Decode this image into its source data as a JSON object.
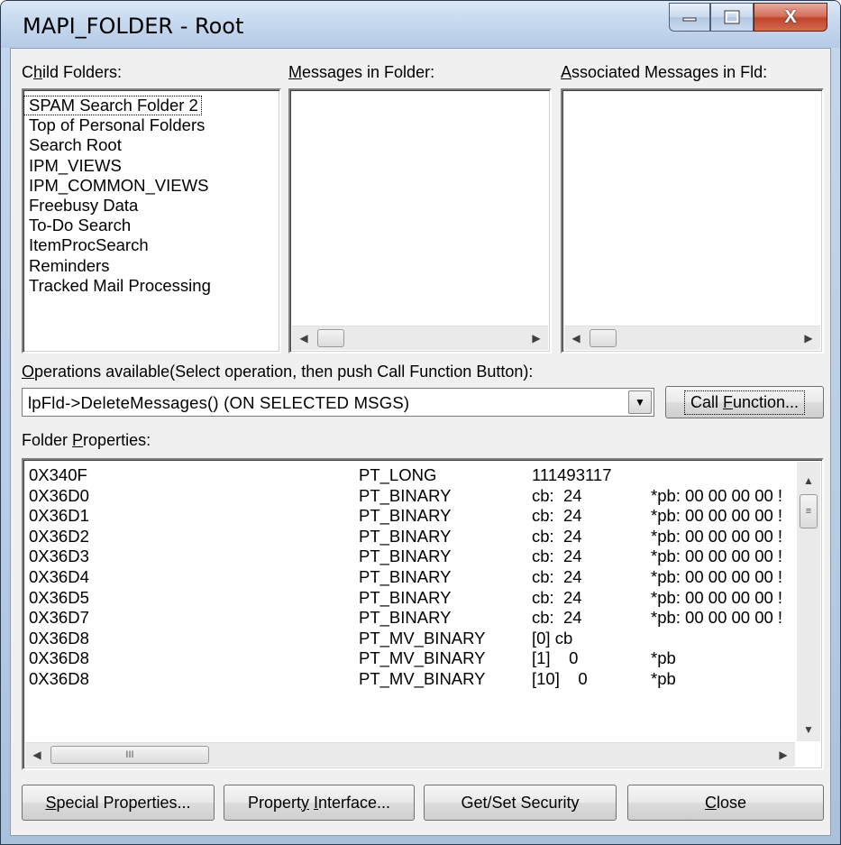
{
  "window": {
    "title": "MAPI_FOLDER - Root",
    "close_symbol": "X"
  },
  "panes": {
    "child_folders_label_u": "C",
    "child_folders_label_rest_pre": "",
    "child_folders_label_rest": "hild Folders:",
    "child_folders_label_first": "C",
    "child_folders_label_u_char": "h",
    "child_folders_label_tail": "ild Folders:",
    "messages_label_u": "M",
    "messages_label_rest": "essages in Folder:",
    "assoc_label_u": "A",
    "assoc_label_rest": "ssociated Messages in Fld:"
  },
  "child_folders": [
    "SPAM Search Folder 2",
    "Top of Personal Folders",
    "Search Root",
    "IPM_VIEWS",
    "IPM_COMMON_VIEWS",
    "Freebusy Data",
    "To-Do Search",
    "ItemProcSearch",
    "Reminders",
    "Tracked Mail Processing"
  ],
  "operations": {
    "label_u": "O",
    "label_rest": "perations available(Select operation, then push Call Function Button):",
    "selected": "lpFld->DeleteMessages()  (ON SELECTED MSGS)",
    "call_button_pre": "Call ",
    "call_button_u": "F",
    "call_button_post": "unction..."
  },
  "properties": {
    "label_pre": "Folder ",
    "label_u": "P",
    "label_post": "roperties:",
    "rows": [
      {
        "tag": "0X340F",
        "type": "PT_LONG",
        "value": "111493117",
        "extra": ""
      },
      {
        "tag": "0X36D0",
        "type": "PT_BINARY",
        "value": "cb:  24",
        "extra": "*pb: 00 00 00 00 !"
      },
      {
        "tag": "0X36D1",
        "type": "PT_BINARY",
        "value": "cb:  24",
        "extra": "*pb: 00 00 00 00 !"
      },
      {
        "tag": "0X36D2",
        "type": "PT_BINARY",
        "value": "cb:  24",
        "extra": "*pb: 00 00 00 00 !"
      },
      {
        "tag": "0X36D3",
        "type": "PT_BINARY",
        "value": "cb:  24",
        "extra": "*pb: 00 00 00 00 !"
      },
      {
        "tag": "0X36D4",
        "type": "PT_BINARY",
        "value": "cb:  24",
        "extra": "*pb: 00 00 00 00 !"
      },
      {
        "tag": "0X36D5",
        "type": "PT_BINARY",
        "value": "cb:  24",
        "extra": "*pb: 00 00 00 00 !"
      },
      {
        "tag": "0X36D7",
        "type": "PT_BINARY",
        "value": "cb:  24",
        "extra": "*pb: 00 00 00 00 !"
      },
      {
        "tag": "0X36D8",
        "type": "PT_MV_BINARY",
        "value": "[0] cb",
        "extra": ""
      },
      {
        "tag": "0X36D8",
        "type": "PT_MV_BINARY",
        "value": "[1]    0",
        "extra": "*pb"
      },
      {
        "tag": "0X36D8",
        "type": "PT_MV_BINARY",
        "value": "[10]    0",
        "extra": "*pb"
      }
    ],
    "hscroll_grip": "III"
  },
  "buttons": {
    "special_u": "S",
    "special_rest": "pecial Properties...",
    "propint_pre": "Propert",
    "propint_u": "y",
    "propint_mid": " ",
    "propint_u2": "I",
    "propint_rest": "nterface...",
    "security": "Get/Set Security",
    "close_u": "C",
    "close_rest": "lose"
  }
}
